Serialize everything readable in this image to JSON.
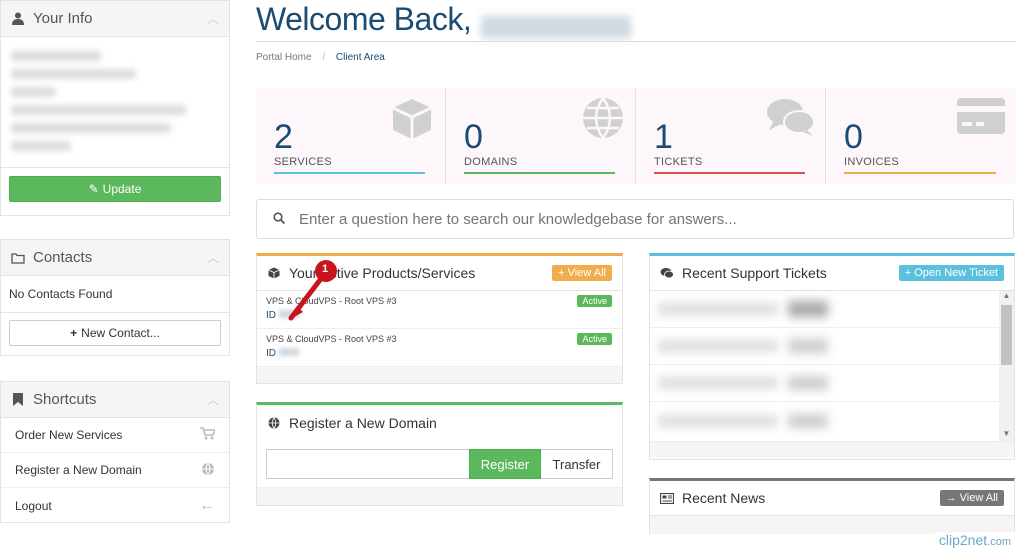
{
  "sidebar": {
    "info": {
      "title": "Your Info",
      "update_label": "Update"
    },
    "contacts": {
      "title": "Contacts",
      "empty_text": "No Contacts Found",
      "new_label": "New Contact..."
    },
    "shortcuts": {
      "title": "Shortcuts",
      "items": [
        {
          "label": "Order New Services",
          "icon": "cart-icon"
        },
        {
          "label": "Register a New Domain",
          "icon": "globe-icon"
        },
        {
          "label": "Logout",
          "icon": "arrow-left-icon"
        }
      ]
    }
  },
  "header": {
    "welcome": "Welcome Back,",
    "breadcrumb": {
      "home": "Portal Home",
      "sep": "/",
      "current": "Client Area"
    }
  },
  "stats": [
    {
      "num": "2",
      "label": "SERVICES",
      "color": "#5bc0de",
      "icon": "cube-icon"
    },
    {
      "num": "0",
      "label": "DOMAINS",
      "color": "#5cb85c",
      "icon": "globe-icon"
    },
    {
      "num": "1",
      "label": "TICKETS",
      "color": "#d9534f",
      "icon": "comments-icon"
    },
    {
      "num": "0",
      "label": "INVOICES",
      "color": "#f0ad4e",
      "icon": "credit-card-icon"
    }
  ],
  "search": {
    "placeholder": "Enter a question here to search our knowledgebase for answers..."
  },
  "products": {
    "title": "Your Active Products/Services",
    "view_all": "View All",
    "items": [
      {
        "name": "VPS & CloudVPS - Root VPS #3",
        "id": "ID",
        "status": "Active"
      },
      {
        "name": "VPS & CloudVPS - Root VPS #3",
        "id": "ID",
        "status": "Active"
      }
    ],
    "annotation": "1"
  },
  "domain": {
    "title": "Register a New Domain",
    "register_label": "Register",
    "transfer_label": "Transfer"
  },
  "tickets": {
    "title": "Recent Support Tickets",
    "open_label": "Open New Ticket"
  },
  "news": {
    "title": "Recent News",
    "view_all": "View All"
  },
  "watermark": {
    "brand": "clip2net",
    "tld": ".com"
  }
}
